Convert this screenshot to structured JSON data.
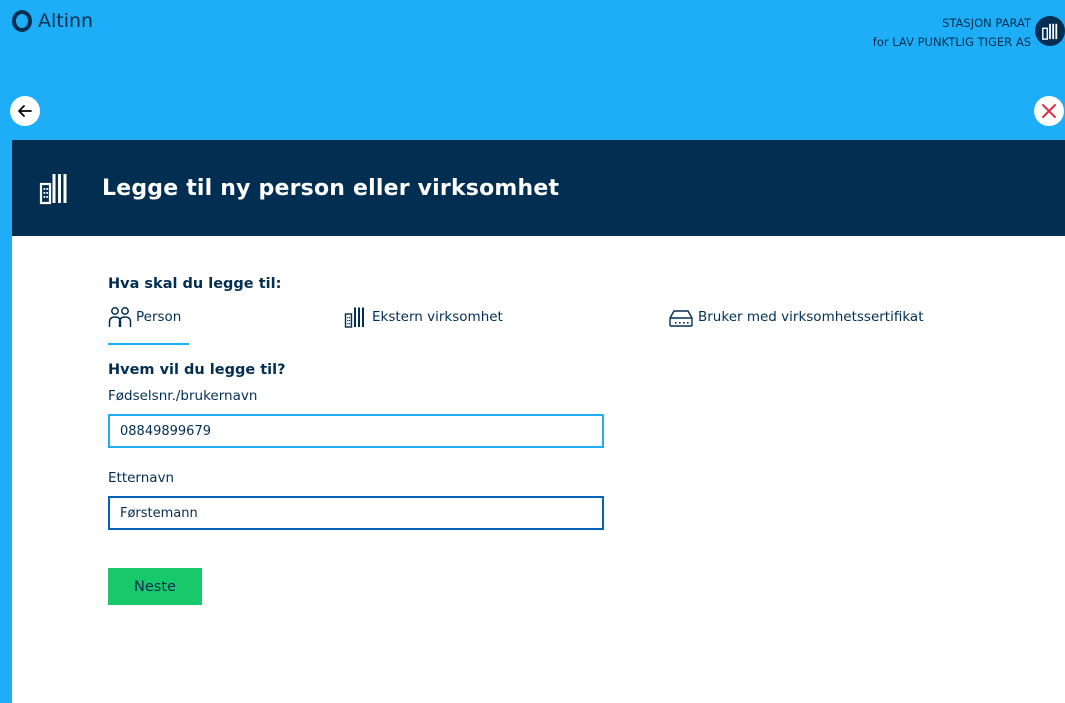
{
  "brand": {
    "name": "Altinn"
  },
  "account": {
    "user": "STASJON PARAT",
    "org": "for LAV PUNKTLIG TIGER AS"
  },
  "modal": {
    "title": "Legge til ny person eller virksomhet",
    "what_label": "Hva skal du legge til:",
    "tabs": [
      {
        "label": "Person",
        "icon": "person-icon",
        "selected": true
      },
      {
        "label": "Ekstern virksomhet",
        "icon": "building-icon",
        "selected": false
      },
      {
        "label": "Bruker med virksomhetssertifikat",
        "icon": "certificate-icon",
        "selected": false
      }
    ],
    "who_label": "Hvem vil du legge til?",
    "ssn_label": "Fødselsnr./brukernavn",
    "ssn_value": "08849899679",
    "lastname_label": "Etternavn",
    "lastname_value": "Førstemann",
    "next_label": "Neste"
  },
  "colors": {
    "brand_blue": "#1eaef7",
    "dark_navy": "#022f51",
    "success_green": "#17c96b",
    "close_red": "#e02e49"
  }
}
